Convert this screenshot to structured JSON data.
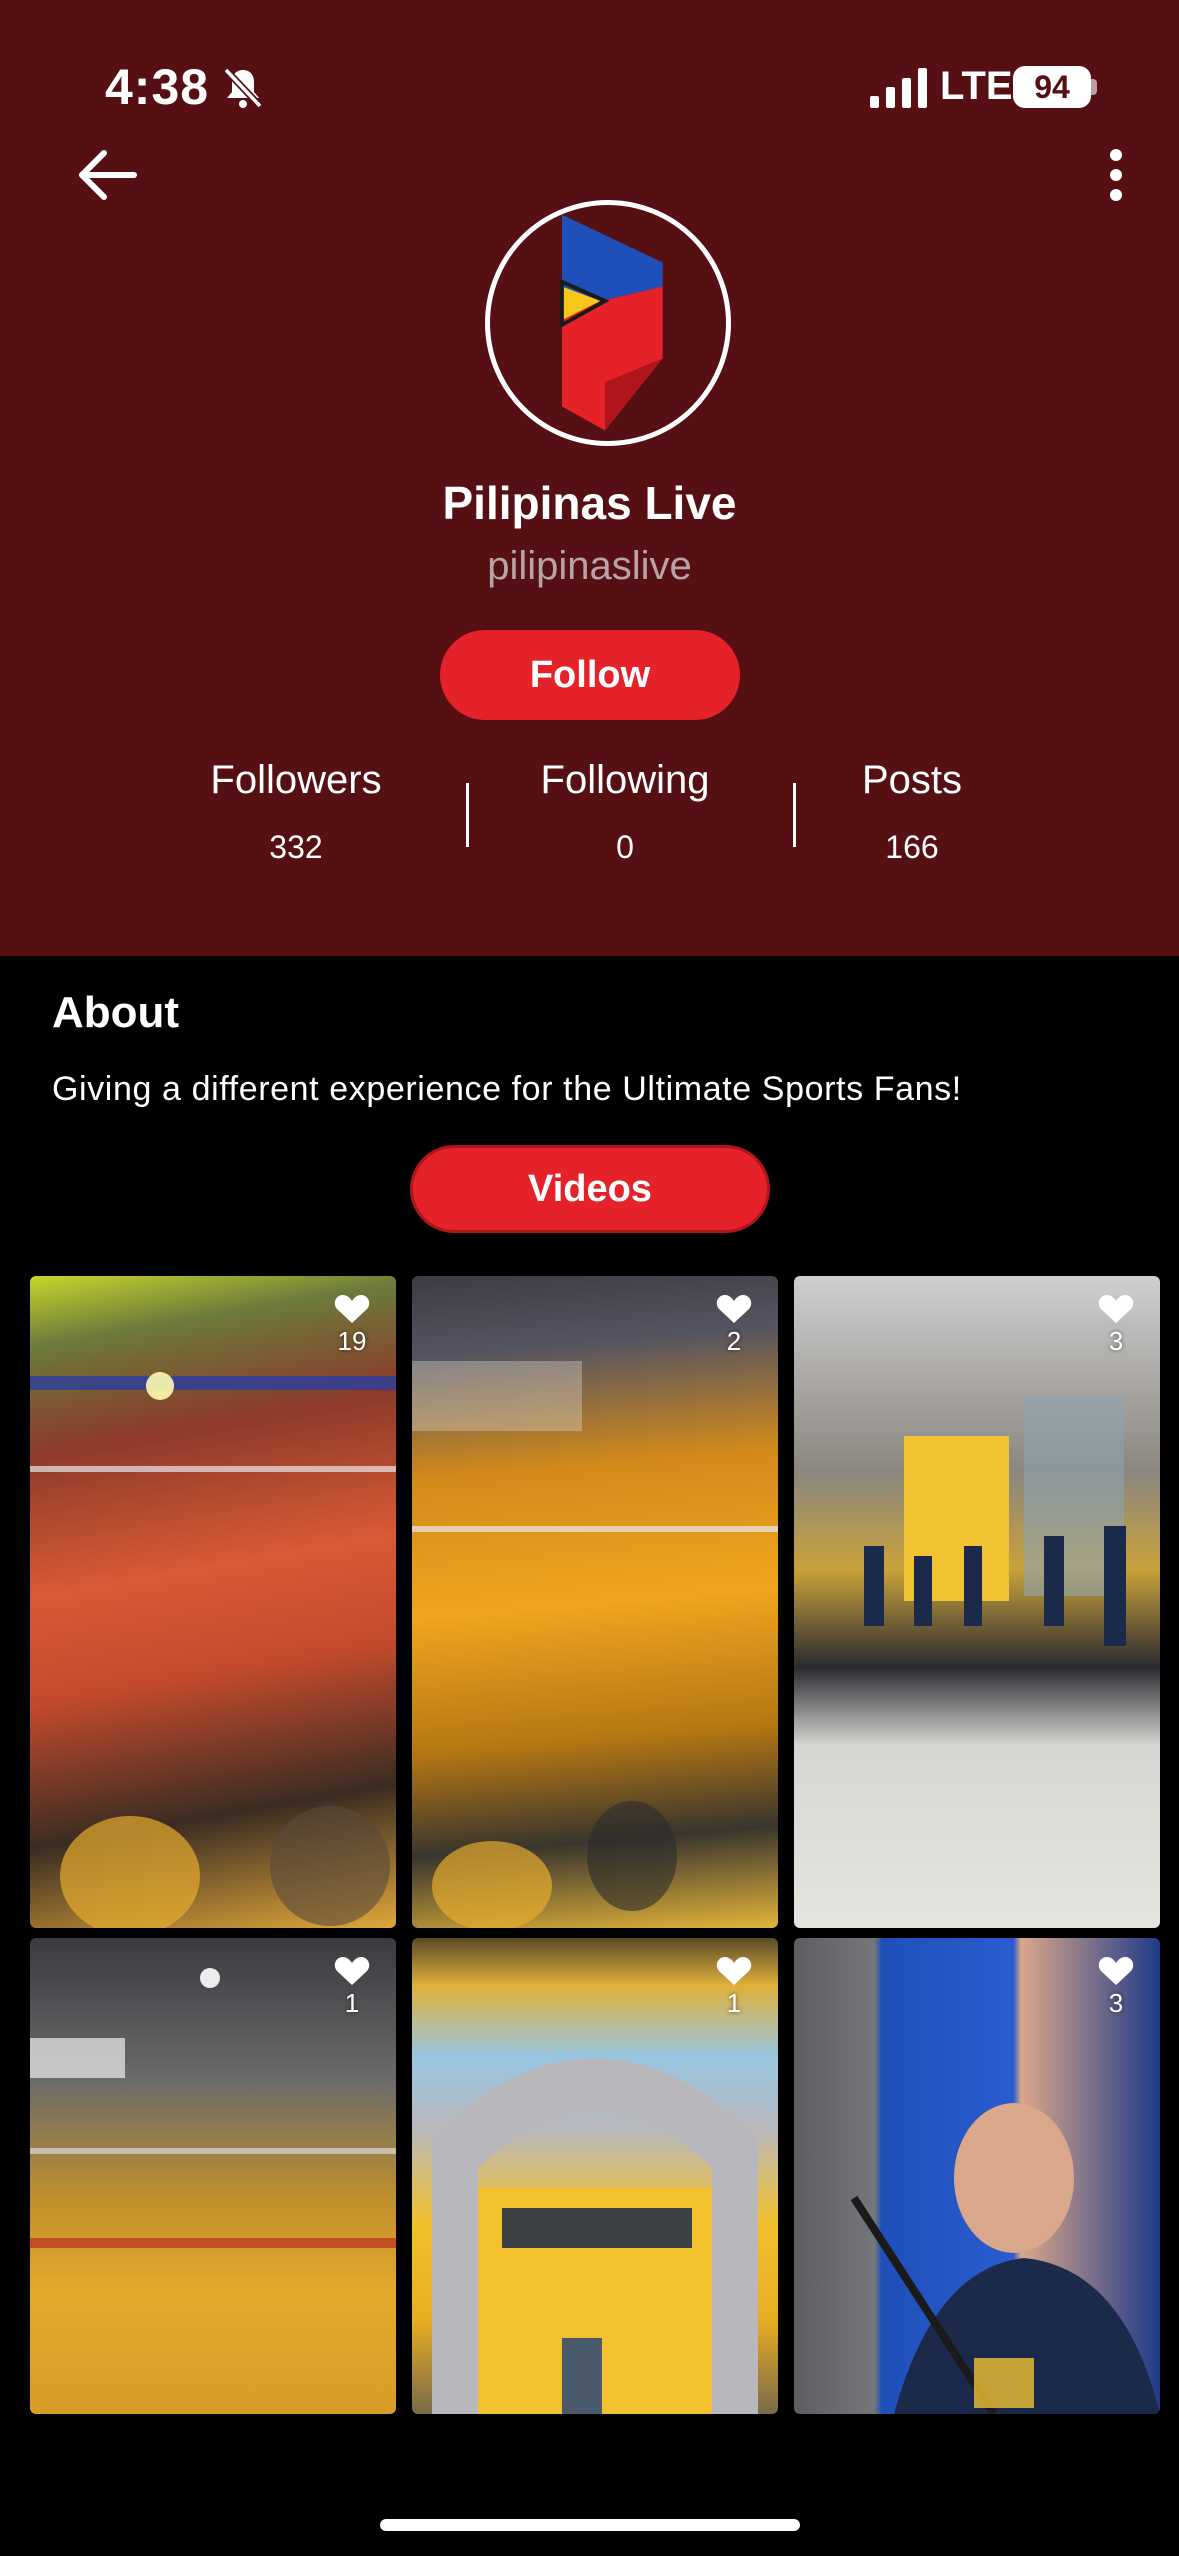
{
  "status_bar": {
    "time": "4:38",
    "network": "LTE",
    "battery": "94"
  },
  "profile": {
    "name": "Pilipinas Live",
    "handle": "pilipinaslive",
    "follow_label": "Follow"
  },
  "stats": {
    "followers_label": "Followers",
    "followers_value": "332",
    "following_label": "Following",
    "following_value": "0",
    "posts_label": "Posts",
    "posts_value": "166"
  },
  "about": {
    "title": "About",
    "text": "Giving a different experience for the Ultimate Sports Fans!",
    "videos_label": "Videos"
  },
  "videos": [
    {
      "likes": "19"
    },
    {
      "likes": "2"
    },
    {
      "likes": "3"
    },
    {
      "likes": "1"
    },
    {
      "likes": "1"
    },
    {
      "likes": "3"
    }
  ],
  "colors": {
    "header_bg": "#561013",
    "accent": "#e5222a",
    "page_bg": "#000000"
  }
}
